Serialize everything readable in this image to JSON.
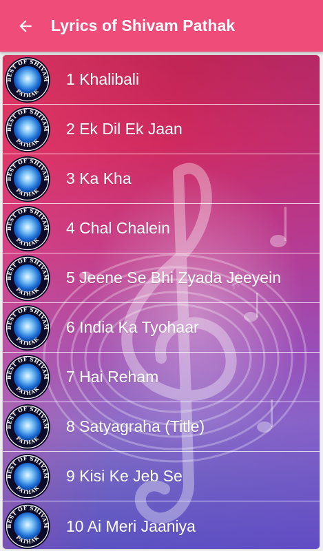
{
  "appbar": {
    "title": "Lyrics of Shivam Pathak",
    "back_icon": "arrow-back-icon",
    "color": "#ef4c7a"
  },
  "badge": {
    "top_text": "BEST OF SHIVAM",
    "bottom_text": "PATHAK"
  },
  "songs": [
    {
      "label": "1 Khalibali"
    },
    {
      "label": "2 Ek Dil Ek Jaan"
    },
    {
      "label": "3 Ka Kha"
    },
    {
      "label": "4 Chal Chalein"
    },
    {
      "label": "5 Jeene Se Bhi Zyada Jeeyein"
    },
    {
      "label": "6 India Ka Tyohaar"
    },
    {
      "label": "7 Hai Reham"
    },
    {
      "label": "8 Satyagraha (Title)"
    },
    {
      "label": "9 Kisi Ke Jeb Se"
    },
    {
      "label": "10 Ai Meri Jaaniya"
    }
  ]
}
